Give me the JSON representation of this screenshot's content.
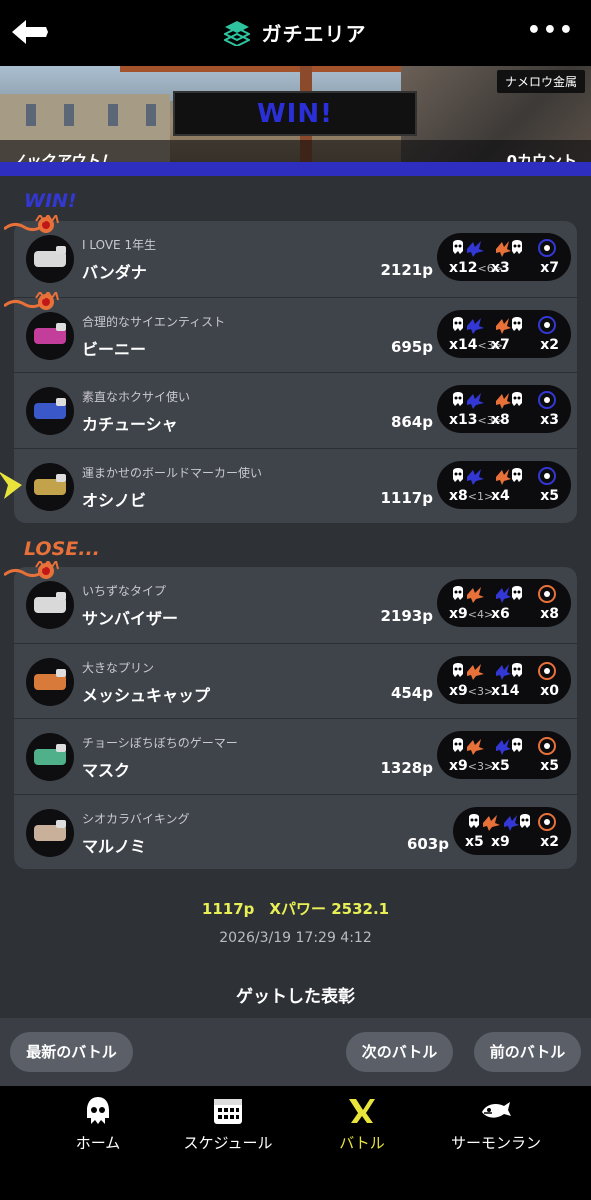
{
  "header": {
    "title": "ガチエリア",
    "back_icon": "back-arrow-icon",
    "more_label": "•••"
  },
  "banner": {
    "result": "WIN!",
    "stage": "ナメロウ金属",
    "knockout": "ノックアウト！",
    "count": "0カウント"
  },
  "win_label": "WIN!",
  "lose_label": "LOSE...",
  "win_team": [
    {
      "byname": "I LOVE 1年生",
      "name": "バンダナ",
      "points": "2121p",
      "kills": "x12",
      "assists": "<6>",
      "deaths": "x3",
      "specials": "x7",
      "crown": true,
      "weapon_color": "#d9d9d9"
    },
    {
      "byname": "合理的なサイエンティスト",
      "name": "ビーニー",
      "points": "695p",
      "kills": "x14",
      "assists": "<3>",
      "deaths": "x7",
      "specials": "x2",
      "crown": true,
      "weapon_color": "#c23e9a"
    },
    {
      "byname": "素直なホクサイ使い",
      "name": "カチューシャ",
      "points": "864p",
      "kills": "x13",
      "assists": "<3>",
      "deaths": "x8",
      "specials": "x3",
      "crown": false,
      "weapon_color": "#3a58c8"
    },
    {
      "byname": "運まかせのボールドマーカー使い",
      "name": "オシノビ",
      "points": "1117p",
      "kills": "x8",
      "assists": "<1>",
      "deaths": "x4",
      "specials": "x5",
      "crown": false,
      "self": true,
      "weapon_color": "#c2a24a"
    }
  ],
  "lose_team": [
    {
      "byname": "いちずなタイプ",
      "name": "サンバイザー",
      "points": "2193p",
      "kills": "x9",
      "assists": "<4>",
      "deaths": "x6",
      "specials": "x8",
      "crown": true,
      "weapon_color": "#d9d9d9"
    },
    {
      "byname": "大きなプリン",
      "name": "メッシュキャップ",
      "points": "454p",
      "kills": "x9",
      "assists": "<3>",
      "deaths": "x14",
      "specials": "x0",
      "crown": false,
      "weapon_color": "#d87a3a"
    },
    {
      "byname": "チョーシぼちぼちのゲーマー",
      "name": "マスク",
      "points": "1328p",
      "kills": "x9",
      "assists": "<3>",
      "deaths": "x5",
      "specials": "x5",
      "crown": false,
      "weapon_color": "#4fb08a"
    },
    {
      "byname": "シオカラバイキング",
      "name": "マルノミ",
      "points": "603p",
      "kills": "x5",
      "assists": "",
      "deaths": "x9",
      "specials": "x2",
      "crown": false,
      "weapon_color": "#c8b09a"
    }
  ],
  "summary": {
    "points_xpower": "1117p　Xパワー 2532.1",
    "datetime": "2026/3/19 17:29 4:12",
    "awards": "ゲットした表彰"
  },
  "nav": {
    "latest": "最新のバトル",
    "next": "次のバトル",
    "prev": "前のバトル"
  },
  "tabs": [
    {
      "label": "ホーム",
      "icon": "squid-home-icon"
    },
    {
      "label": "スケジュール",
      "icon": "calendar-icon"
    },
    {
      "label": "バトル",
      "icon": "battle-icon",
      "active": true
    },
    {
      "label": "サーモンラン",
      "icon": "salmon-icon"
    }
  ],
  "colors": {
    "win": "#3338d4",
    "lose": "#e8713a",
    "xpower": "#e9f055",
    "active_tab": "#e9e43b"
  }
}
